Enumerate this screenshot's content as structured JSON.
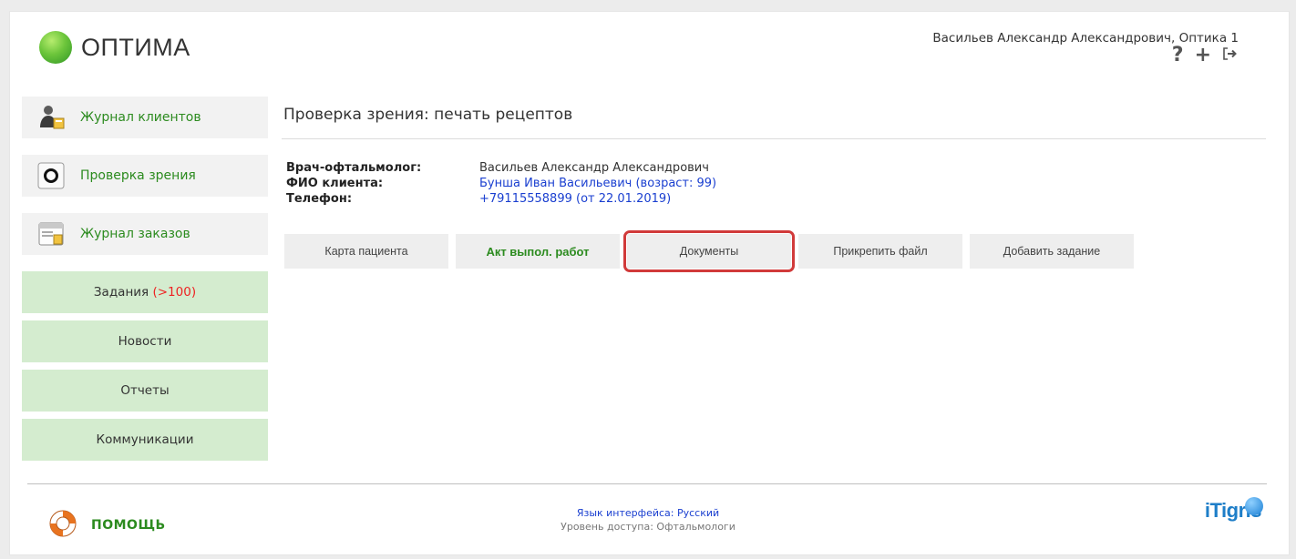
{
  "header": {
    "app_name": "ОПТИМА",
    "user": "Васильев Александр Александрович, Оптика 1"
  },
  "sidebar": {
    "main_items": [
      {
        "label": "Журнал клиентов",
        "icon": "client-journal-icon"
      },
      {
        "label": "Проверка зрения",
        "icon": "eye-check-icon"
      },
      {
        "label": "Журнал заказов",
        "icon": "orders-journal-icon"
      }
    ],
    "secondary_items": [
      {
        "label": "Задания",
        "count": "(>100)"
      },
      {
        "label": "Новости"
      },
      {
        "label": "Отчеты"
      },
      {
        "label": "Коммуникации"
      }
    ]
  },
  "main": {
    "title": "Проверка зрения: печать рецептов",
    "info": {
      "doctor_label": "Врач-офтальмолог:",
      "doctor_value": "Васильев Александр Александрович",
      "client_label": "ФИО клиента:",
      "client_value": "Бунша Иван Васильевич (возраст: 99)",
      "phone_label": "Телефон:",
      "phone_value": "+79115558899 (от 22.01.2019)"
    },
    "tabs": [
      "Карта пациента",
      "Акт выпол. работ",
      "Документы",
      "Прикрепить файл",
      "Добавить задание"
    ]
  },
  "footer": {
    "help": "ПОМОЩЬ",
    "language": "Язык интерфейса: Русский",
    "access_level": "Уровень доступа: Офтальмологи",
    "brand": "iTigris"
  },
  "colors": {
    "accent_green": "#2c8b1f",
    "link_blue": "#1a3fd0",
    "highlight_red": "#d13a3a",
    "sidebar_green_bg": "#d4eccf"
  }
}
